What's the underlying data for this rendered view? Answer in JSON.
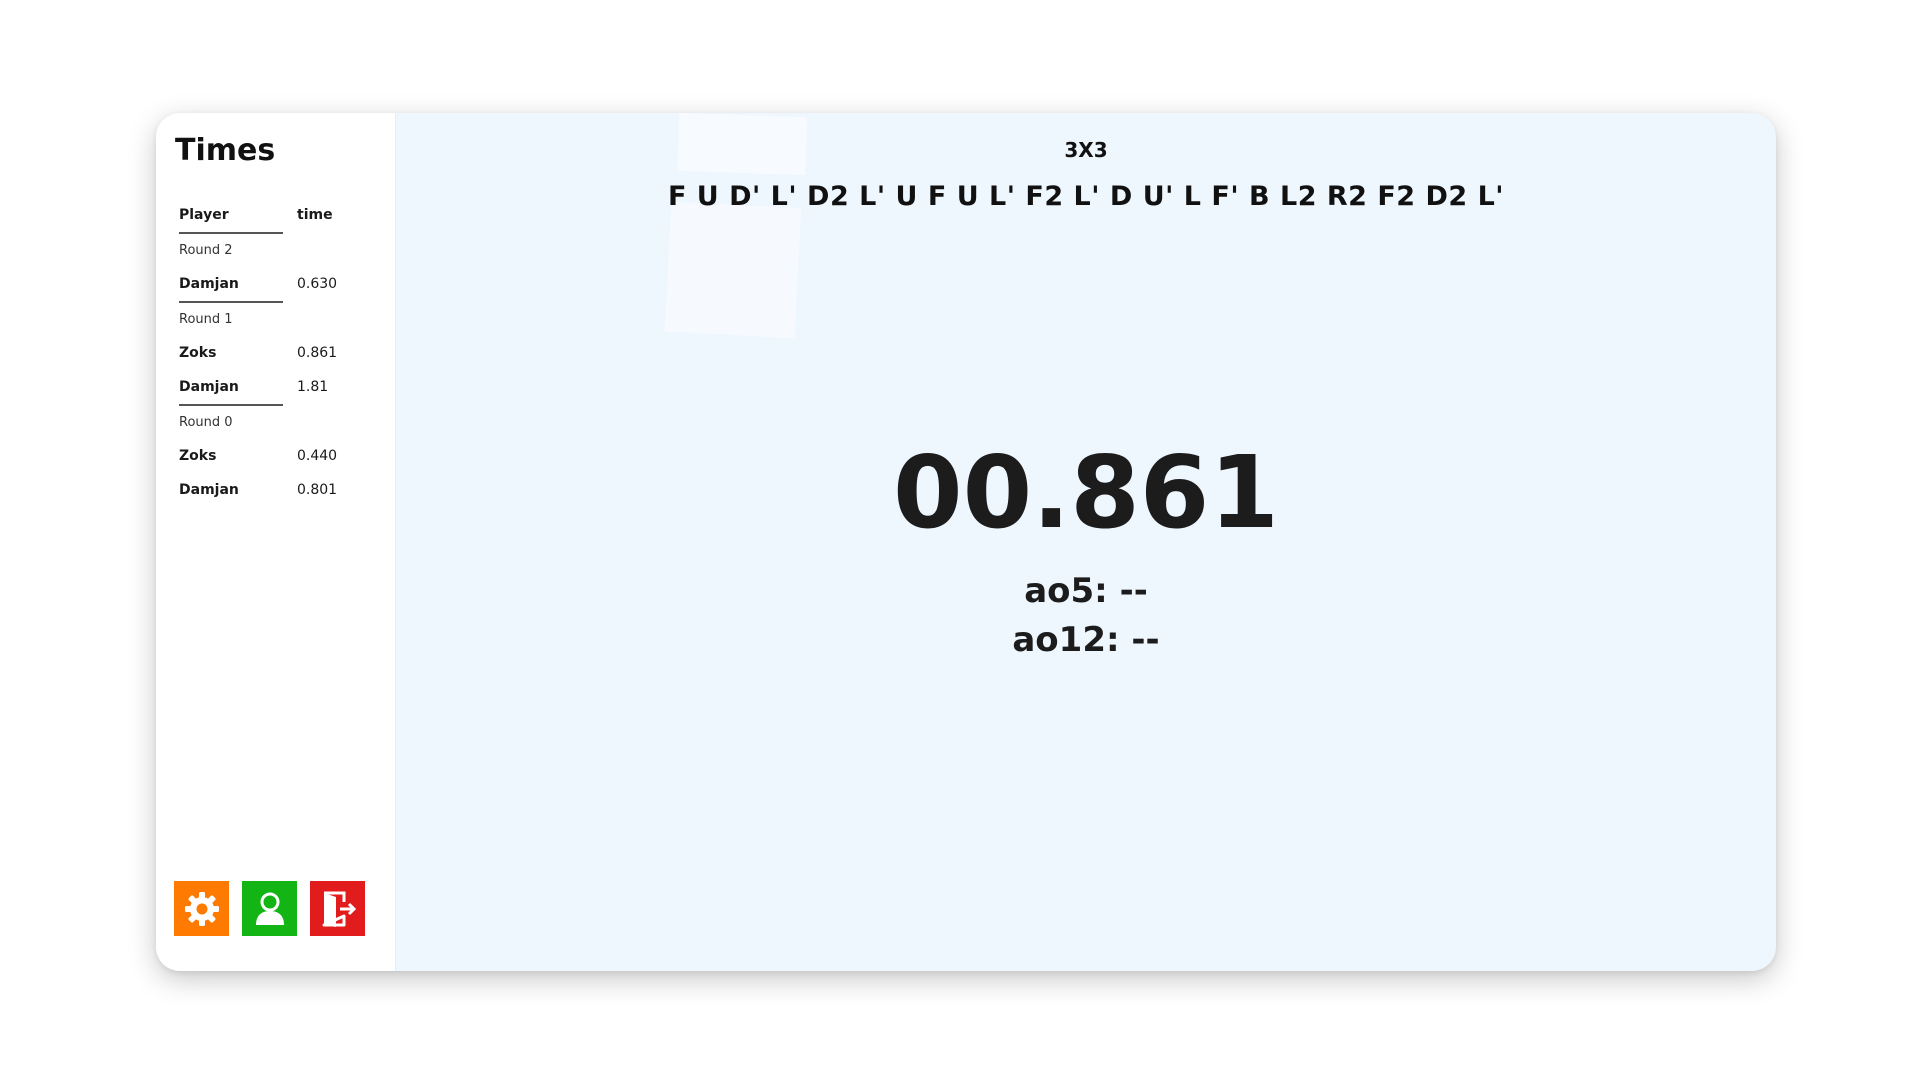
{
  "sidebar": {
    "title": "Times",
    "headers": {
      "player": "Player",
      "time": "time"
    },
    "rounds": [
      {
        "label": "Round 2",
        "entries": [
          {
            "player": "Damjan",
            "time": "0.630"
          }
        ]
      },
      {
        "label": "Round 1",
        "entries": [
          {
            "player": "Zoks",
            "time": "0.861"
          },
          {
            "player": "Damjan",
            "time": "1.81"
          }
        ]
      },
      {
        "label": "Round 0",
        "entries": [
          {
            "player": "Zoks",
            "time": "0.440"
          },
          {
            "player": "Damjan",
            "time": "0.801"
          }
        ]
      }
    ],
    "buttons": [
      {
        "name": "settings-button",
        "icon": "gear-icon",
        "color": "#ff7a00"
      },
      {
        "name": "profile-button",
        "icon": "user-icon",
        "color": "#12b514"
      },
      {
        "name": "logout-button",
        "icon": "exit-door-icon",
        "color": "#e21c1c"
      }
    ]
  },
  "main": {
    "puzzle_type": "3X3",
    "scramble": "F U D' L' D2 L' U F U L' F2 L' D U' L F' B L2 R2 F2 D2 L'",
    "timer": "00.861",
    "ao5": "ao5: --",
    "ao12": "ao12: --"
  },
  "colors": {
    "main_background": "#eef6fe",
    "sidebar_background": "#ffffff"
  }
}
